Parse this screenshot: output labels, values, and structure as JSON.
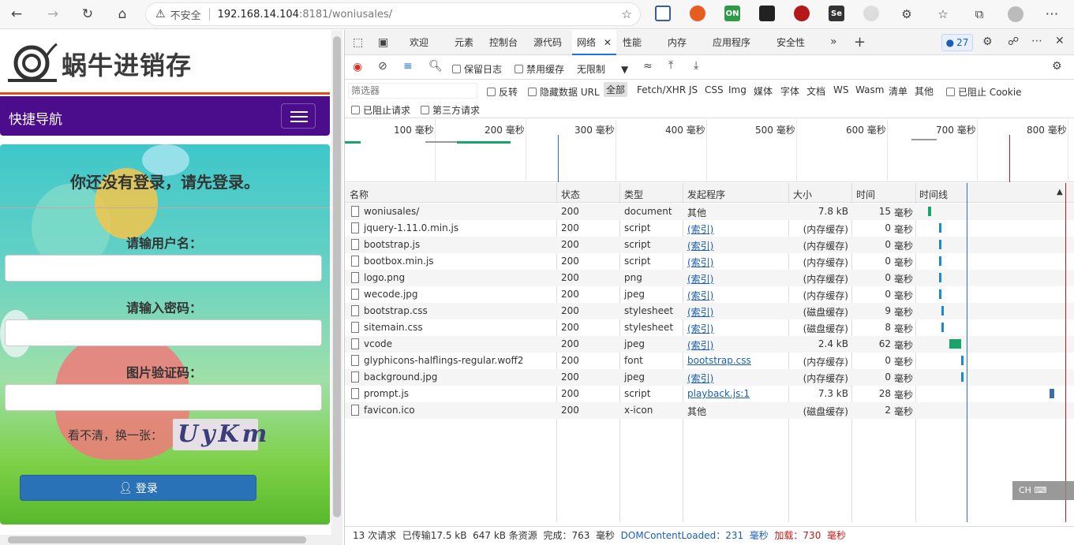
{
  "browser": {
    "security_label": "不安全",
    "url_host": "192.168.14.104",
    "url_rest": ":8181/woniusales/",
    "extension_on_label": "ON",
    "extension_se_label": "Se"
  },
  "site": {
    "logo_text": "蜗牛进销存",
    "nav_title": "快捷导航",
    "login_title": "你还没有登录，请先登录。",
    "username_label": "请输用户名：",
    "password_label": "请输入密码：",
    "captcha_label": "图片验证码：",
    "refresh_label": "看不清，换一张：",
    "captcha_text": "UyKm",
    "login_button": "登录"
  },
  "devtools": {
    "tabs": [
      "欢迎",
      "元素",
      "控制台",
      "源代码",
      "网络",
      "性能",
      "内存",
      "应用程序",
      "安全性"
    ],
    "issues_count": "27",
    "throttle": "无限制",
    "preserve_log": "保留日志",
    "disable_cache": "禁用缓存",
    "filter_placeholder": "筛选器",
    "invert": "反转",
    "hide_data_url": "隐藏数据 URL",
    "types": [
      "全部",
      "Fetch/XHR",
      "JS",
      "CSS",
      "Img",
      "媒体",
      "字体",
      "文档",
      "WS",
      "Wasm",
      "清单",
      "其他"
    ],
    "blocked_cookies": "已阻止 Cookie",
    "blocked_requests": "已阻止请求",
    "third_party": "第三方请求",
    "ticks": [
      "100",
      "200",
      "300",
      "400",
      "500",
      "600",
      "700",
      "800"
    ],
    "tick_unit": "毫秒",
    "columns": {
      "name": "名称",
      "status": "状态",
      "type": "类型",
      "initiator": "发起程序",
      "size": "大小",
      "time": "时间",
      "waterfall": "时间线"
    },
    "time_unit": "毫秒",
    "rows": [
      {
        "name": "woniusales/",
        "status": "200",
        "type": "document",
        "initiator": "其他",
        "initiator_link": false,
        "size": "7.8 kB",
        "time": "15",
        "tl_start": 0.06,
        "tl_len": 0.02,
        "tl_color": "#1aa36b"
      },
      {
        "name": "jquery-1.11.0.min.js",
        "status": "200",
        "type": "script",
        "initiator": "(索引)",
        "initiator_link": true,
        "size": "(内存缓存)",
        "time": "0",
        "tl_start": 0.13,
        "tl_len": 0.012,
        "tl_color": "#1a8ad4"
      },
      {
        "name": "bootstrap.js",
        "status": "200",
        "type": "script",
        "initiator": "(索引)",
        "initiator_link": true,
        "size": "(内存缓存)",
        "time": "0",
        "tl_start": 0.13,
        "tl_len": 0.008,
        "tl_color": "#1a8ad4"
      },
      {
        "name": "bootbox.min.js",
        "status": "200",
        "type": "script",
        "initiator": "(索引)",
        "initiator_link": true,
        "size": "(内存缓存)",
        "time": "0",
        "tl_start": 0.13,
        "tl_len": 0.008,
        "tl_color": "#1a8ad4"
      },
      {
        "name": "logo.png",
        "status": "200",
        "type": "png",
        "initiator": "(索引)",
        "initiator_link": true,
        "size": "(内存缓存)",
        "time": "0",
        "tl_start": 0.13,
        "tl_len": 0.008,
        "tl_color": "#1a8ad4"
      },
      {
        "name": "wecode.jpg",
        "status": "200",
        "type": "jpeg",
        "initiator": "(索引)",
        "initiator_link": true,
        "size": "(内存缓存)",
        "time": "0",
        "tl_start": 0.13,
        "tl_len": 0.008,
        "tl_color": "#1a8ad4"
      },
      {
        "name": "bootstrap.css",
        "status": "200",
        "type": "stylesheet",
        "initiator": "(索引)",
        "initiator_link": true,
        "size": "(磁盘缓存)",
        "time": "9",
        "tl_start": 0.145,
        "tl_len": 0.02,
        "tl_color": "#1a8ad4"
      },
      {
        "name": "sitemain.css",
        "status": "200",
        "type": "stylesheet",
        "initiator": "(索引)",
        "initiator_link": true,
        "size": "(磁盘缓存)",
        "time": "8",
        "tl_start": 0.145,
        "tl_len": 0.02,
        "tl_color": "#1a8ad4"
      },
      {
        "name": "vcode",
        "status": "200",
        "type": "jpeg",
        "initiator": "(索引)",
        "initiator_link": true,
        "size": "2.4 kB",
        "time": "62",
        "tl_start": 0.2,
        "tl_len": 0.08,
        "tl_color": "#1aa36b"
      },
      {
        "name": "glyphicons-halflings-regular.woff2",
        "status": "200",
        "type": "font",
        "initiator": "bootstrap.css",
        "initiator_link": true,
        "size": "(内存缓存)",
        "time": "0",
        "tl_start": 0.28,
        "tl_len": 0.008,
        "tl_color": "#1a8ad4"
      },
      {
        "name": "background.jpg",
        "status": "200",
        "type": "jpeg",
        "initiator": "(索引)",
        "initiator_link": true,
        "size": "(内存缓存)",
        "time": "0",
        "tl_start": 0.28,
        "tl_len": 0.008,
        "tl_color": "#1a8ad4"
      },
      {
        "name": "prompt.js",
        "status": "200",
        "type": "script",
        "initiator": "playback.js:1",
        "initiator_link": true,
        "size": "7.3 kB",
        "time": "28",
        "tl_start": 0.87,
        "tl_len": 0.03,
        "tl_color": "#3c6fa6"
      },
      {
        "name": "favicon.ico",
        "status": "200",
        "type": "x-icon",
        "initiator": "其他",
        "initiator_link": false,
        "size": "(磁盘缓存)",
        "time": "2",
        "tl_start": 0,
        "tl_len": 0,
        "tl_color": "#1a8ad4"
      }
    ],
    "status_bar": {
      "requests": "13 次请求",
      "transferred": "已传输17.5 kB",
      "resources": "647 kB 条资源",
      "finish_label": "完成：763",
      "dcl_label": "DOMContentLoaded：231",
      "load_label": "加载：730",
      "unit": "毫秒"
    },
    "ime": "CH"
  }
}
